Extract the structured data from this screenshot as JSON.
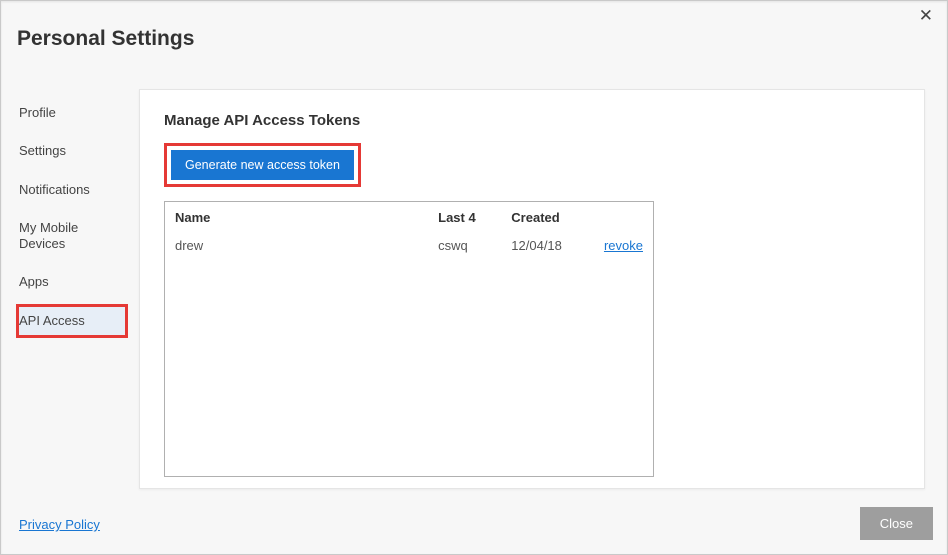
{
  "title": "Personal Settings",
  "close_x": "✕",
  "sidebar": {
    "items": [
      {
        "label": "Profile",
        "active": false
      },
      {
        "label": "Settings",
        "active": false
      },
      {
        "label": "Notifications",
        "active": false
      },
      {
        "label": "My Mobile Devices",
        "active": false
      },
      {
        "label": "Apps",
        "active": false
      },
      {
        "label": "API Access",
        "active": true,
        "highlighted": true
      }
    ]
  },
  "panel": {
    "heading": "Manage API Access Tokens",
    "generate_button_label": "Generate new access token",
    "generate_button_highlighted": true,
    "table": {
      "columns": {
        "name": "Name",
        "last4": "Last 4",
        "created": "Created"
      },
      "rows": [
        {
          "name": "drew",
          "last4": "cswq",
          "created": "12/04/18",
          "action_label": "revoke"
        }
      ]
    }
  },
  "footer": {
    "privacy_label": "Privacy Policy",
    "close_label": "Close"
  }
}
